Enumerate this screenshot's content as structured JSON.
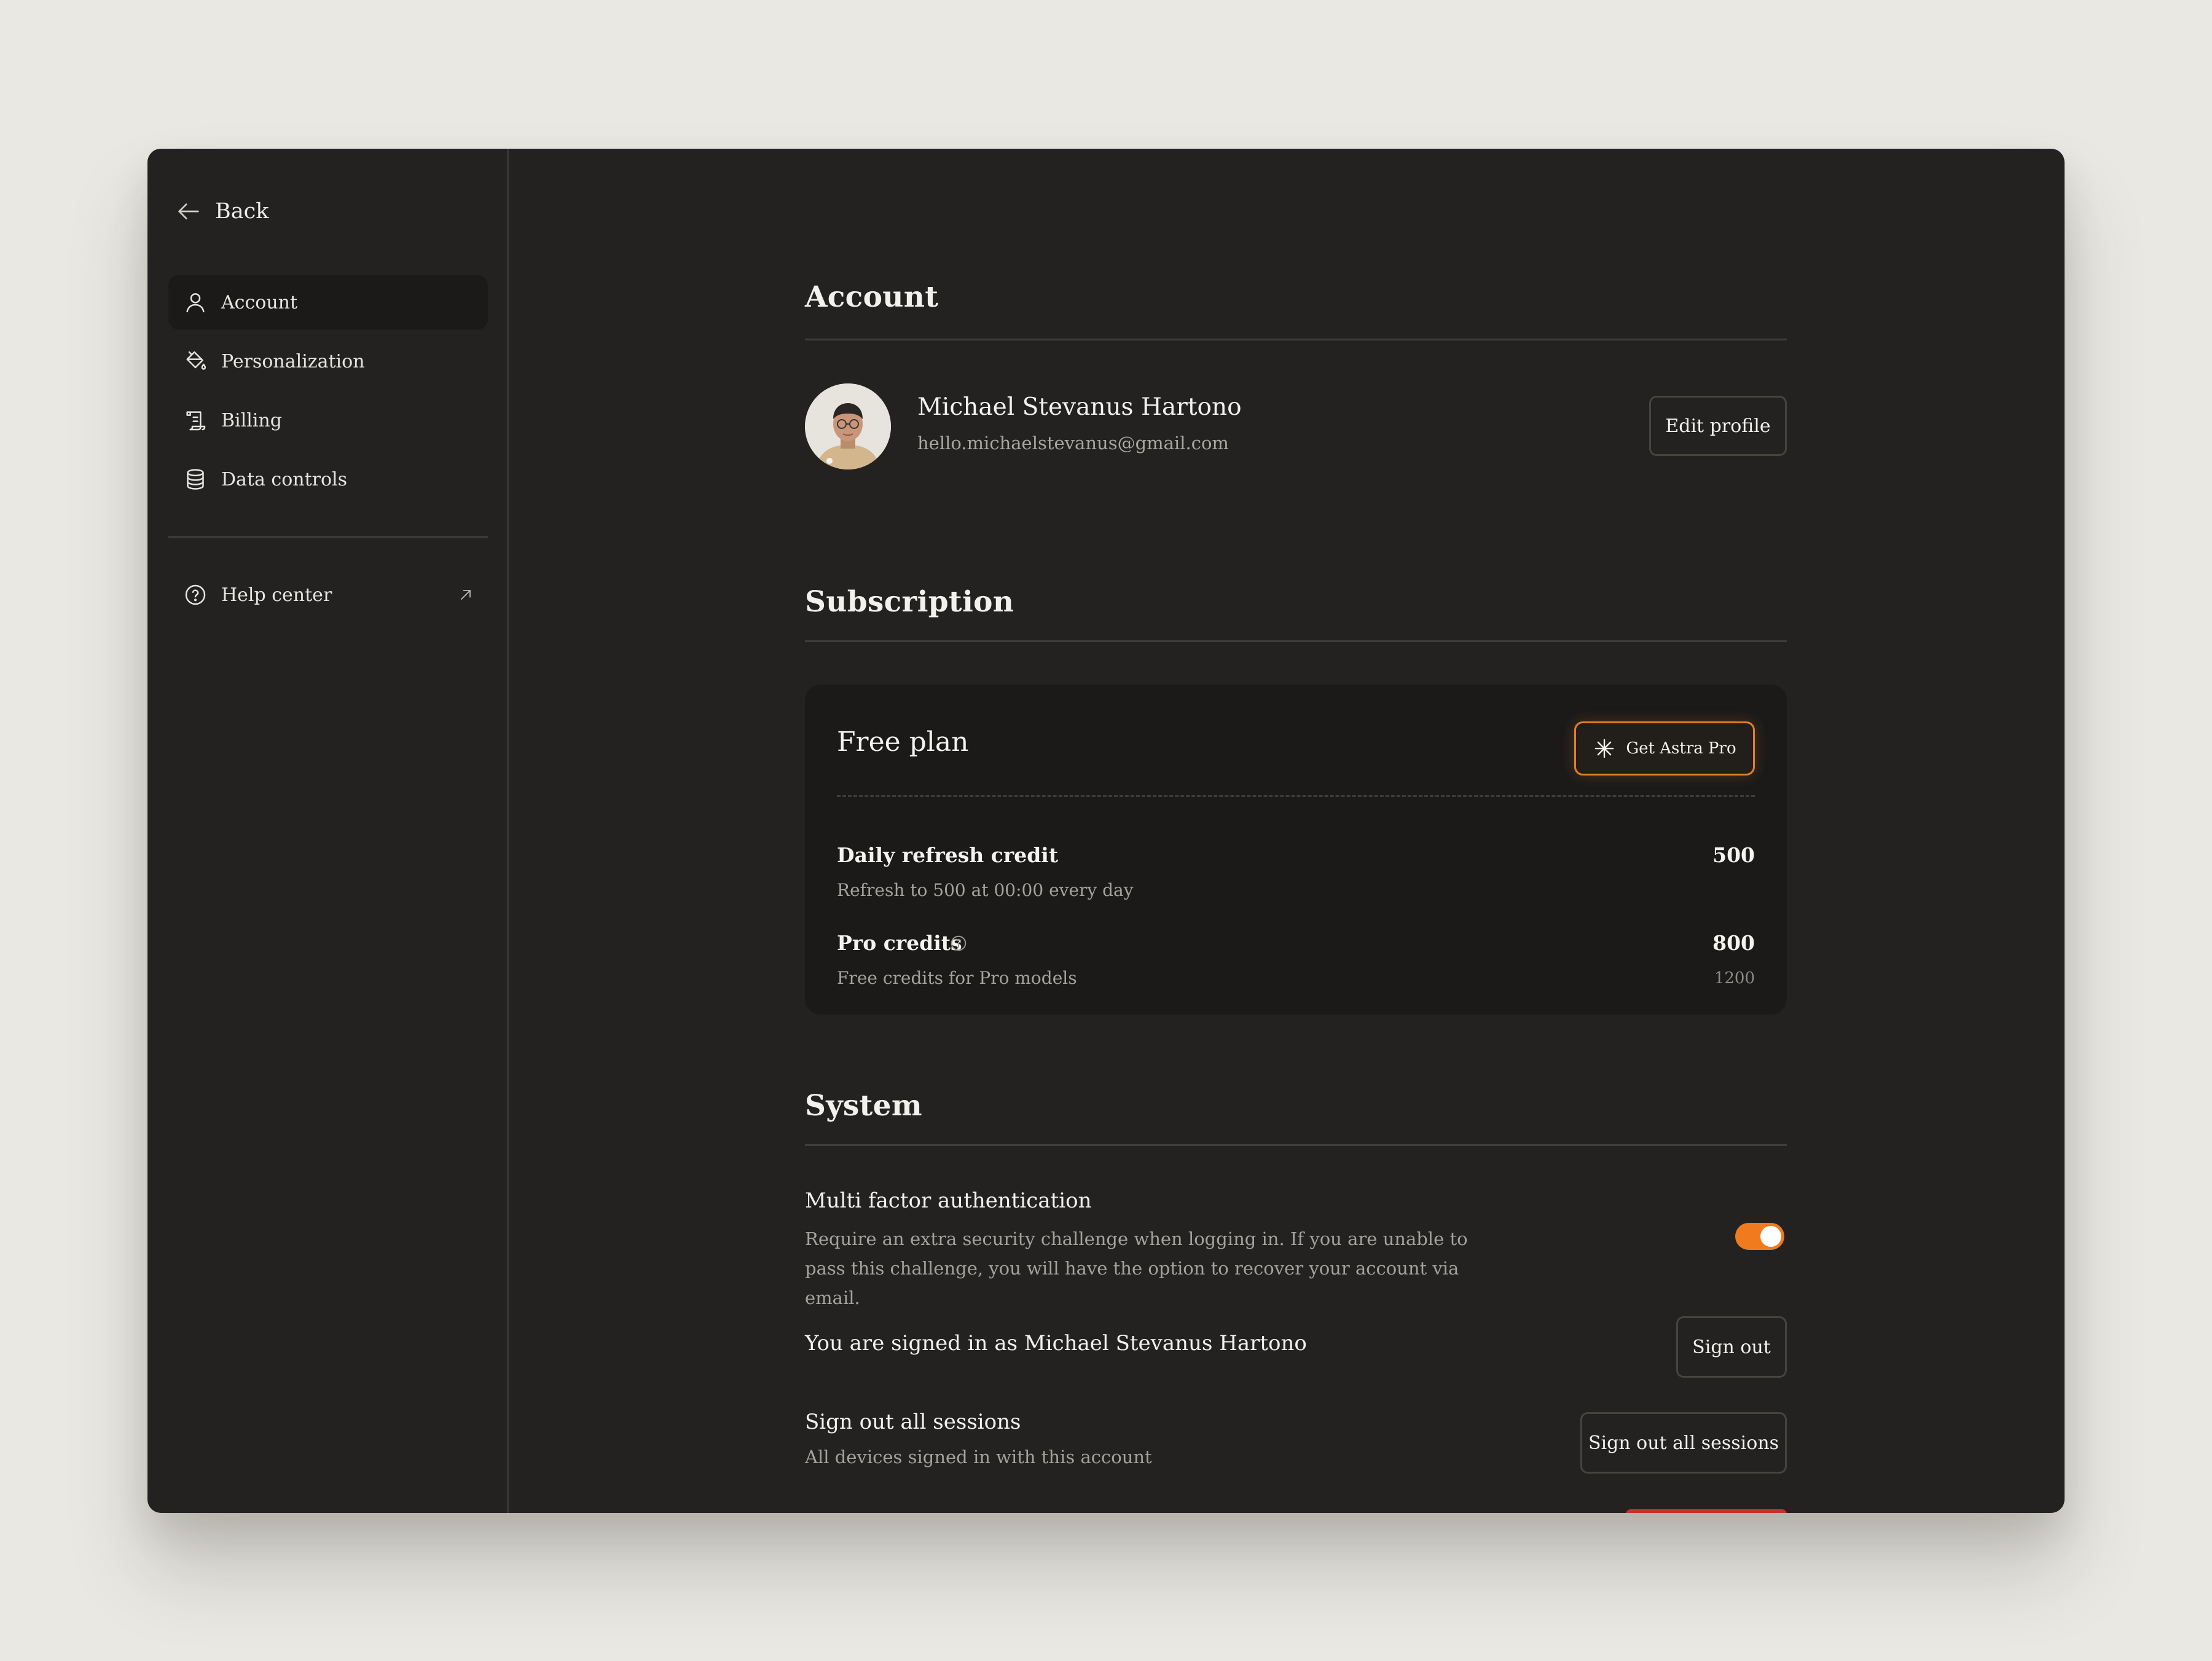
{
  "sidebar": {
    "back_label": "Back",
    "items": [
      {
        "label": "Account",
        "icon": "user-icon",
        "active": true
      },
      {
        "label": "Personalization",
        "icon": "paint-bucket-icon",
        "active": false
      },
      {
        "label": "Billing",
        "icon": "receipt-icon",
        "active": false
      },
      {
        "label": "Data controls",
        "icon": "database-icon",
        "active": false
      }
    ],
    "help_label": "Help center"
  },
  "account": {
    "title": "Account",
    "name": "Michael Stevanus Hartono",
    "email": "hello.michaelstevanus@gmail.com",
    "edit_label": "Edit profile"
  },
  "subscription": {
    "title": "Subscription",
    "plan_name": "Free plan",
    "upgrade_label": "Get Astra Pro",
    "daily": {
      "label": "Daily refresh credit",
      "description": "Refresh to 500 at 00:00 every day",
      "value": "500"
    },
    "pro": {
      "label": "Pro credits",
      "description": "Free credits for Pro models",
      "value": "800",
      "total": "1200"
    }
  },
  "system": {
    "title": "System",
    "mfa": {
      "label": "Multi factor authentication",
      "description": "Require an extra security challenge when logging in. If you are unable to pass this challenge, you will have the option to recover your account via email.",
      "enabled": true
    },
    "signed_in": {
      "label": "You are signed in as Michael Stevanus Hartono",
      "button": "Sign out"
    },
    "sessions": {
      "label": "Sign out all sessions",
      "description": "All devices signed in with this account",
      "button": "Sign out all sessions"
    }
  },
  "colors": {
    "accent": "#ef7b1e",
    "window_bg": "#232221",
    "card_bg": "#1b1a19",
    "page_bg": "#e9e8e2",
    "danger": "#c0332c"
  }
}
